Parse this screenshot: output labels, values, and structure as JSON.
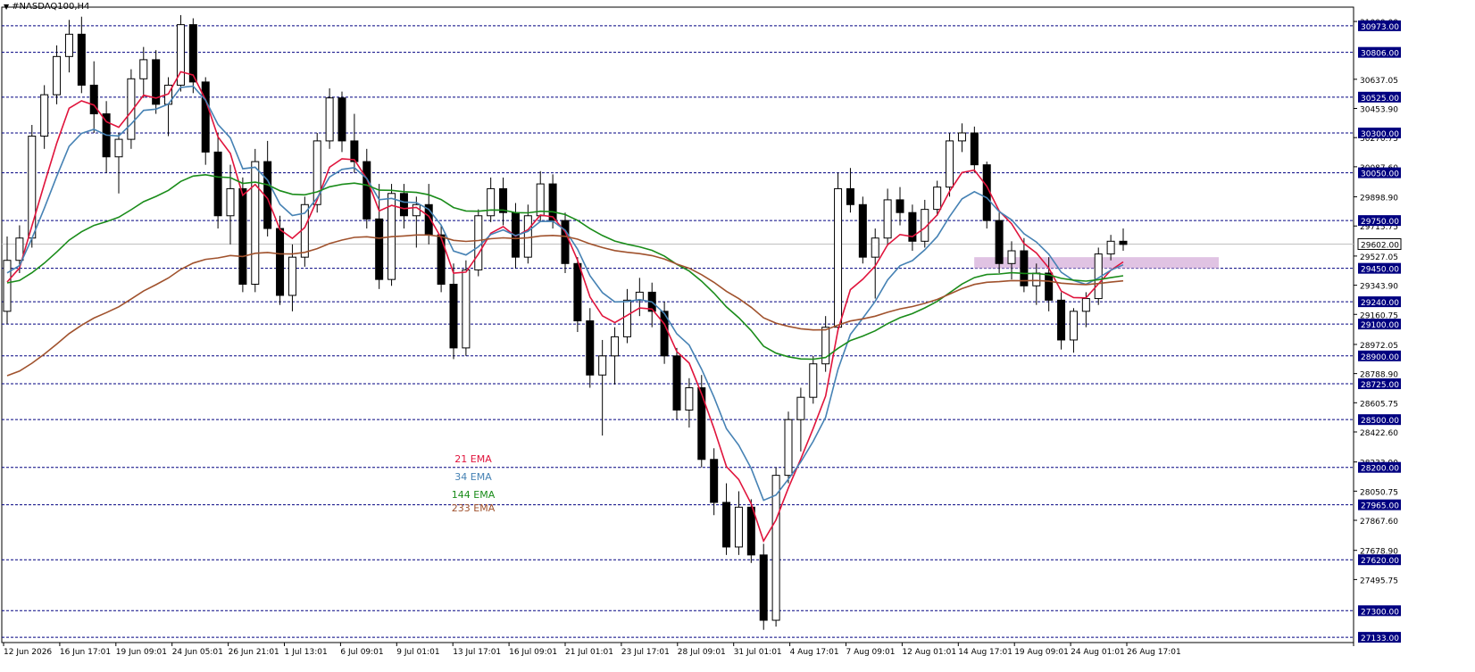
{
  "window": {
    "title": "#NASDAQ100,H4"
  },
  "colors": {
    "bull": "#000000",
    "bear": "#000000",
    "ema21": "#e0143c",
    "ema34": "#4682b4",
    "ema144": "#1a8c1a",
    "ema233": "#a0522d",
    "level_line": "#000080",
    "label_bg": "#000080",
    "label_text": "#ffffff",
    "current_line": "#c0c0c0",
    "zone": "#d8b4dc"
  },
  "chart_data": {
    "type": "candlestick",
    "symbol": "#NASDAQ100",
    "timeframe": "H4",
    "ylim": [
      27100,
      31090
    ],
    "price_scale_ticks": [
      "31000.00",
      "30637.05",
      "30453.90",
      "30270.75",
      "30087.60",
      "29898.90",
      "29715.75",
      "29527.05",
      "29343.90",
      "29160.75",
      "28972.05",
      "28788.90",
      "28605.75",
      "28422.60",
      "28233.90",
      "28050.75",
      "27867.60",
      "27678.90",
      "27495.75"
    ],
    "date_labels": [
      "12 Jun 2026",
      "16 Jun 17:01",
      "19 Jun 09:01",
      "24 Jun 05:01",
      "26 Jun 21:01",
      "1 Jul 13:01",
      "6 Jul 09:01",
      "9 Jul 01:01",
      "13 Jul 17:01",
      "16 Jul 09:01",
      "21 Jul 01:01",
      "23 Jul 17:01",
      "28 Jul 09:01",
      "31 Jul 01:01",
      "4 Aug 17:01",
      "7 Aug 09:01",
      "12 Aug 01:01",
      "14 Aug 17:01",
      "19 Aug 09:01",
      "24 Aug 01:01",
      "26 Aug 17:01"
    ],
    "horizontal_levels": [
      "30973.00",
      "30806.00",
      "30525.00",
      "30300.00",
      "30050.00",
      "29750.00",
      "29450.00",
      "29240.00",
      "29100.00",
      "28900.00",
      "28725.00",
      "28500.00",
      "28200.00",
      "27965.00",
      "27620.00",
      "27300.00",
      "27133.00"
    ],
    "current_price": "29602.00",
    "zone": {
      "low": 29450,
      "high": 29520,
      "start_date": "15 Aug 09:01"
    },
    "legend": [
      {
        "label": "21 EMA",
        "color": "#e0143c"
      },
      {
        "label": "34 EMA",
        "color": "#4682b4"
      },
      {
        "label": "144 EMA",
        "color": "#1a8c1a"
      },
      {
        "label": "233 EMA",
        "color": "#a0522d"
      }
    ],
    "candles": [
      [
        29180,
        29650,
        29100,
        29500
      ],
      [
        29500,
        29720,
        29420,
        29640
      ],
      [
        29640,
        30350,
        29580,
        30280
      ],
      [
        30280,
        30600,
        30200,
        30540
      ],
      [
        30540,
        30850,
        30480,
        30780
      ],
      [
        30780,
        31010,
        30680,
        30920
      ],
      [
        30920,
        31030,
        30550,
        30600
      ],
      [
        30600,
        30750,
        30300,
        30420
      ],
      [
        30420,
        30500,
        30050,
        30150
      ],
      [
        30150,
        30300,
        29920,
        30260
      ],
      [
        30260,
        30700,
        30200,
        30640
      ],
      [
        30640,
        30840,
        30520,
        30760
      ],
      [
        30760,
        30820,
        30420,
        30480
      ],
      [
        30480,
        30650,
        30280,
        30600
      ],
      [
        30600,
        31040,
        30560,
        30980
      ],
      [
        30980,
        31020,
        30550,
        30620
      ],
      [
        30620,
        30650,
        30100,
        30180
      ],
      [
        30180,
        30300,
        29700,
        29780
      ],
      [
        29780,
        30100,
        29600,
        29950
      ],
      [
        29950,
        30020,
        29300,
        29350
      ],
      [
        29350,
        30200,
        29300,
        30120
      ],
      [
        30120,
        30250,
        29650,
        29700
      ],
      [
        29700,
        29780,
        29220,
        29280
      ],
      [
        29280,
        29600,
        29180,
        29520
      ],
      [
        29520,
        29900,
        29460,
        29850
      ],
      [
        29850,
        30300,
        29800,
        30250
      ],
      [
        30250,
        30580,
        30200,
        30520
      ],
      [
        30520,
        30560,
        30180,
        30250
      ],
      [
        30250,
        30420,
        30050,
        30120
      ],
      [
        30120,
        30200,
        29700,
        29760
      ],
      [
        29760,
        29980,
        29320,
        29380
      ],
      [
        29380,
        29980,
        29340,
        29920
      ],
      [
        29920,
        29980,
        29700,
        29780
      ],
      [
        29780,
        29900,
        29580,
        29850
      ],
      [
        29850,
        29980,
        29600,
        29660
      ],
      [
        29660,
        29720,
        29300,
        29350
      ],
      [
        29350,
        29480,
        28880,
        28950
      ],
      [
        28950,
        29500,
        28900,
        29440
      ],
      [
        29440,
        29820,
        29400,
        29780
      ],
      [
        29780,
        30020,
        29740,
        29950
      ],
      [
        29950,
        30020,
        29720,
        29800
      ],
      [
        29800,
        29860,
        29450,
        29520
      ],
      [
        29520,
        29850,
        29480,
        29780
      ],
      [
        29780,
        30060,
        29740,
        29980
      ],
      [
        29980,
        30040,
        29700,
        29750
      ],
      [
        29750,
        29800,
        29420,
        29480
      ],
      [
        29480,
        29520,
        29050,
        29120
      ],
      [
        29120,
        29200,
        28700,
        28780
      ],
      [
        28780,
        29000,
        28400,
        28900
      ],
      [
        28900,
        29080,
        28720,
        29020
      ],
      [
        29020,
        29320,
        28980,
        29250
      ],
      [
        29250,
        29390,
        29150,
        29300
      ],
      [
        29300,
        29360,
        29080,
        29180
      ],
      [
        29180,
        29240,
        28850,
        28900
      ],
      [
        28900,
        28950,
        28500,
        28560
      ],
      [
        28560,
        28760,
        28450,
        28700
      ],
      [
        28700,
        28780,
        28200,
        28250
      ],
      [
        28250,
        28320,
        27900,
        27980
      ],
      [
        27980,
        28100,
        27650,
        27700
      ],
      [
        27700,
        28050,
        27650,
        27950
      ],
      [
        27950,
        28000,
        27600,
        27650
      ],
      [
        27650,
        27720,
        27180,
        27240
      ],
      [
        27240,
        28200,
        27200,
        28150
      ],
      [
        28150,
        28550,
        28100,
        28500
      ],
      [
        28500,
        28700,
        28300,
        28640
      ],
      [
        28640,
        28900,
        28600,
        28850
      ],
      [
        28850,
        29150,
        28800,
        29080
      ],
      [
        29080,
        30050,
        29050,
        29950
      ],
      [
        29950,
        30080,
        29800,
        29850
      ],
      [
        29850,
        29900,
        29480,
        29520
      ],
      [
        29520,
        29700,
        29260,
        29640
      ],
      [
        29640,
        29950,
        29600,
        29880
      ],
      [
        29880,
        29960,
        29720,
        29800
      ],
      [
        29800,
        29850,
        29560,
        29620
      ],
      [
        29620,
        29880,
        29580,
        29820
      ],
      [
        29820,
        30000,
        29780,
        29960
      ],
      [
        29960,
        30300,
        29900,
        30250
      ],
      [
        30250,
        30360,
        30180,
        30300
      ],
      [
        30300,
        30340,
        30050,
        30100
      ],
      [
        30100,
        30120,
        29700,
        29750
      ],
      [
        29750,
        29800,
        29420,
        29480
      ],
      [
        29480,
        29620,
        29380,
        29560
      ],
      [
        29560,
        29640,
        29300,
        29340
      ],
      [
        29340,
        29480,
        29220,
        29420
      ],
      [
        29420,
        29520,
        29180,
        29250
      ],
      [
        29250,
        29300,
        28940,
        29000
      ],
      [
        29000,
        29200,
        28920,
        29180
      ],
      [
        29180,
        29300,
        29080,
        29260
      ],
      [
        29260,
        29580,
        29220,
        29540
      ],
      [
        29540,
        29660,
        29500,
        29620
      ],
      [
        29620,
        29700,
        29560,
        29600
      ]
    ]
  }
}
